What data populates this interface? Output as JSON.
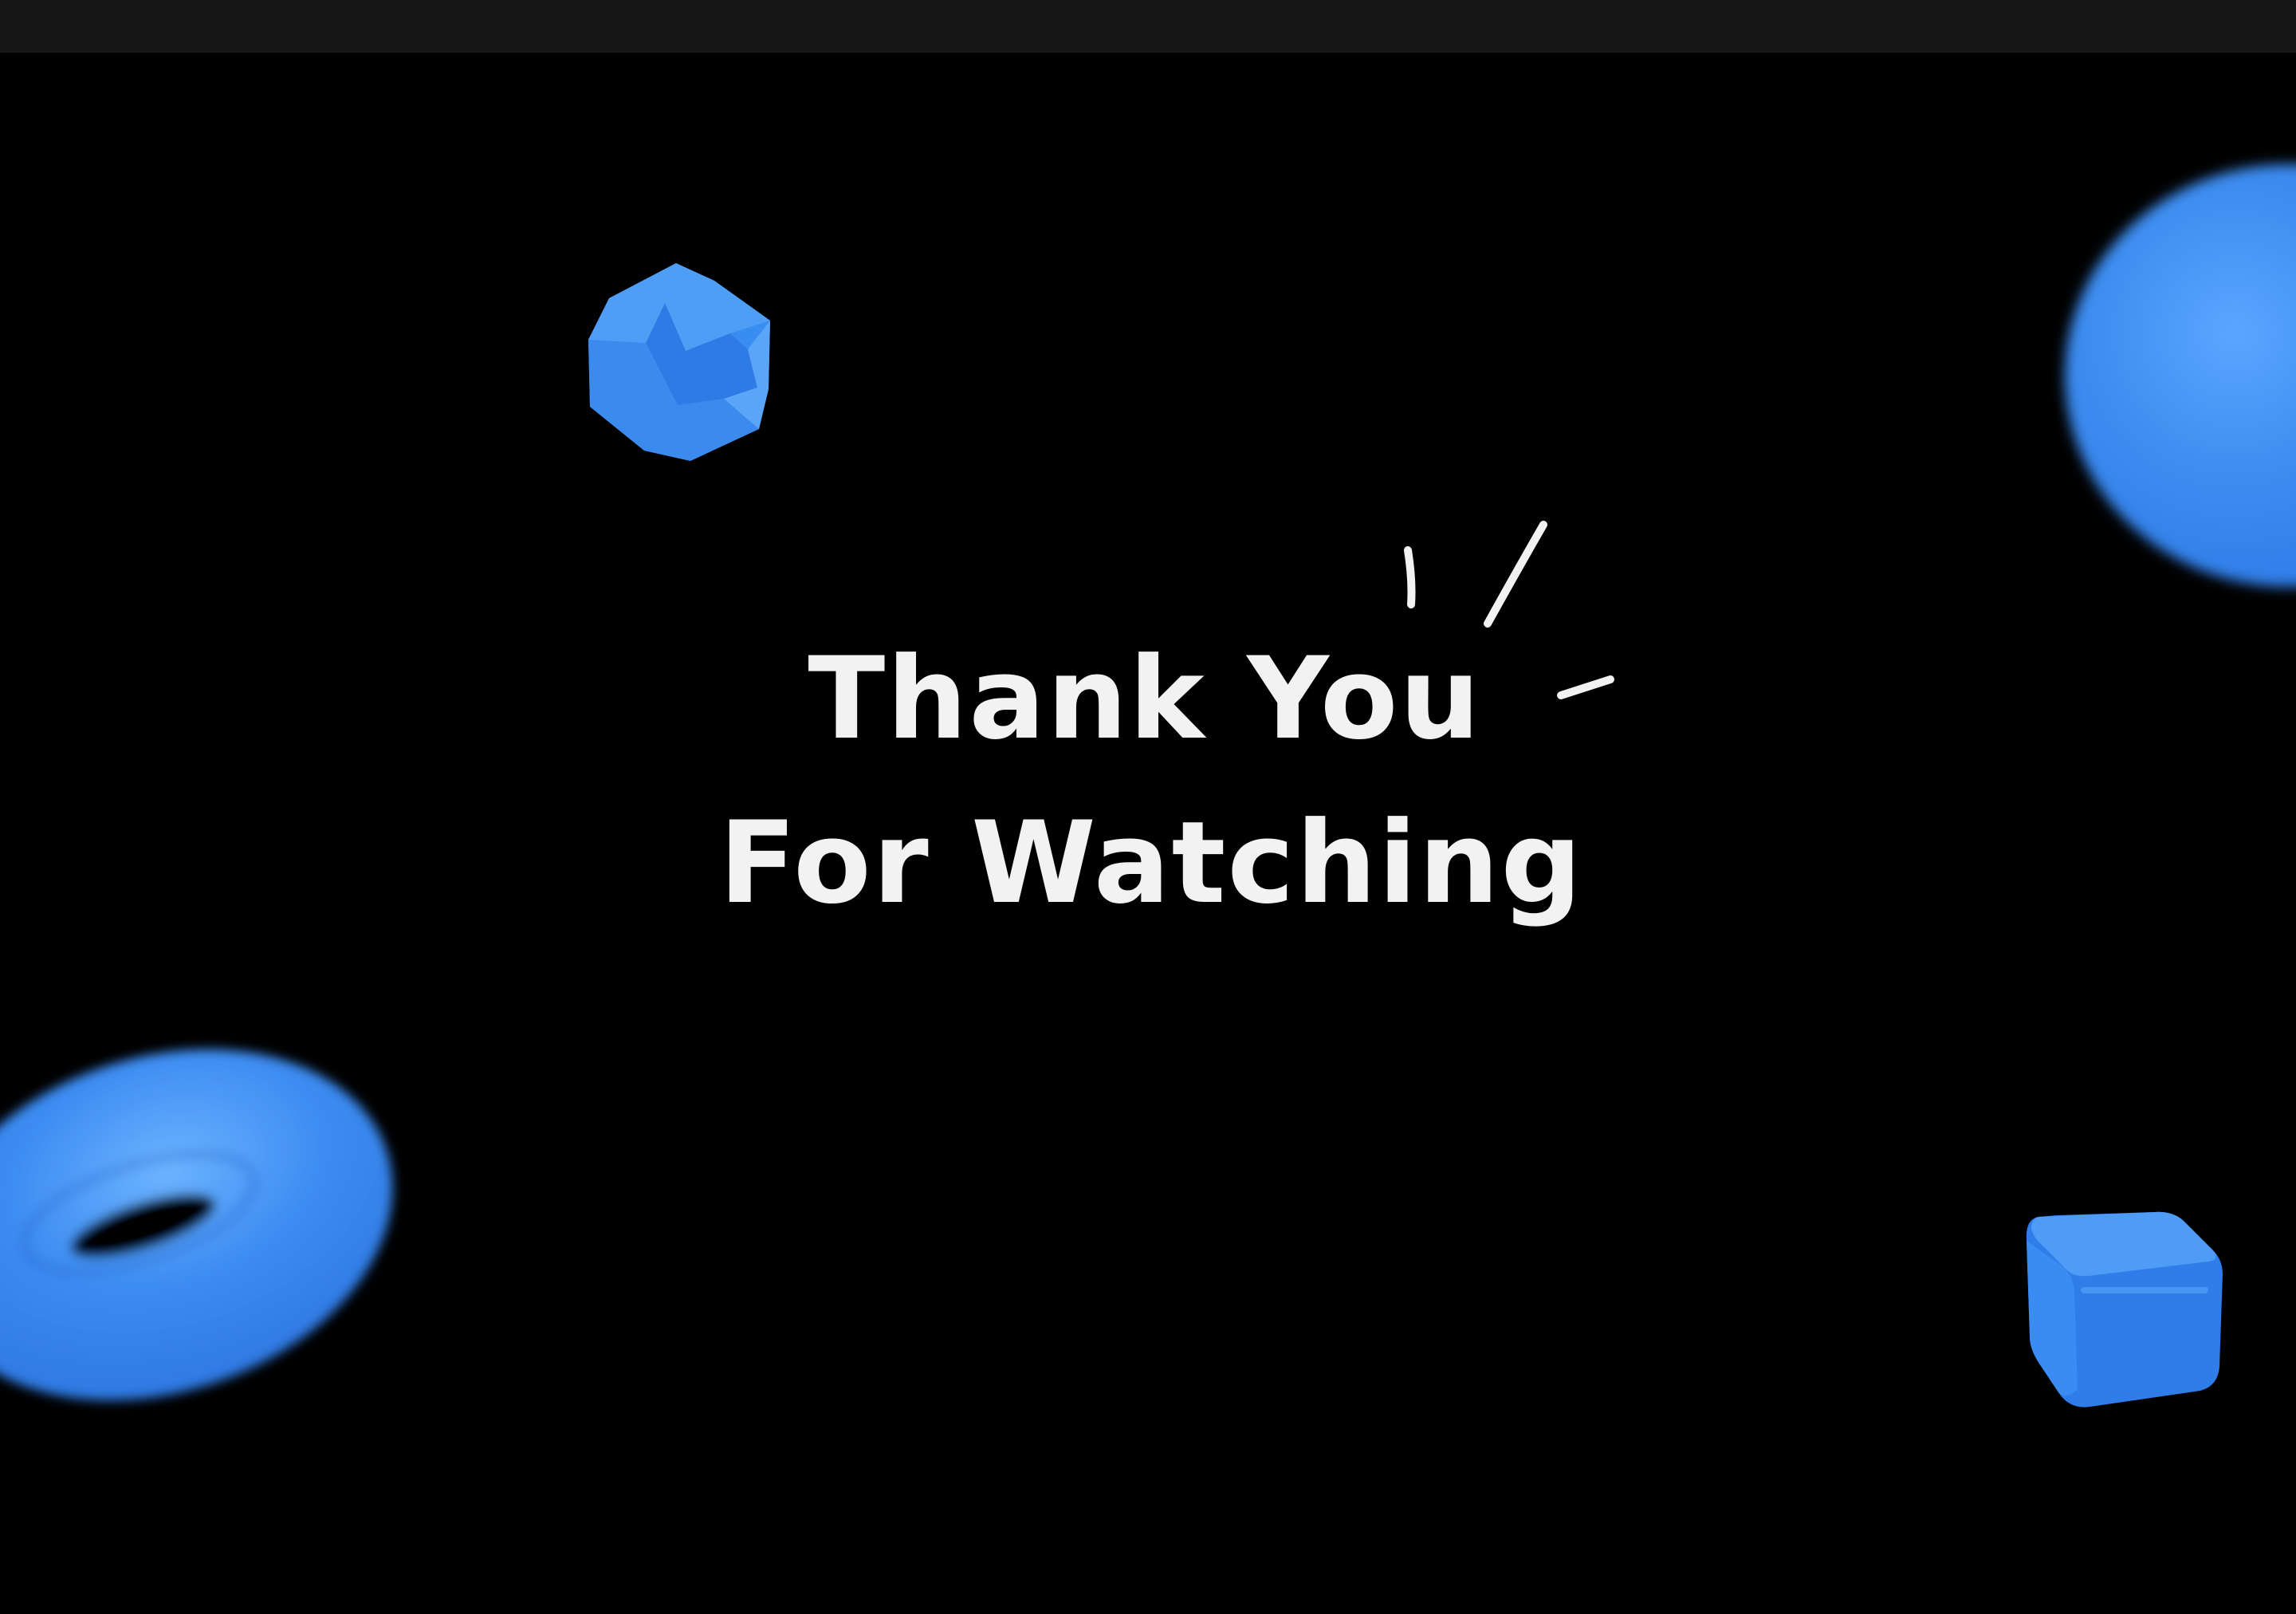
{
  "slide": {
    "title_line1": "Thank You",
    "title_line2": "For Watching"
  },
  "colors": {
    "background": "#000000",
    "top_bar": "#171717",
    "text": "#f2f2f2",
    "shape_blue": "#2f7de8"
  },
  "decorations": {
    "sparkle": "sparkle-strokes-icon",
    "shapes": [
      "dodecahedron",
      "sphere",
      "torus",
      "rounded-cube"
    ]
  }
}
